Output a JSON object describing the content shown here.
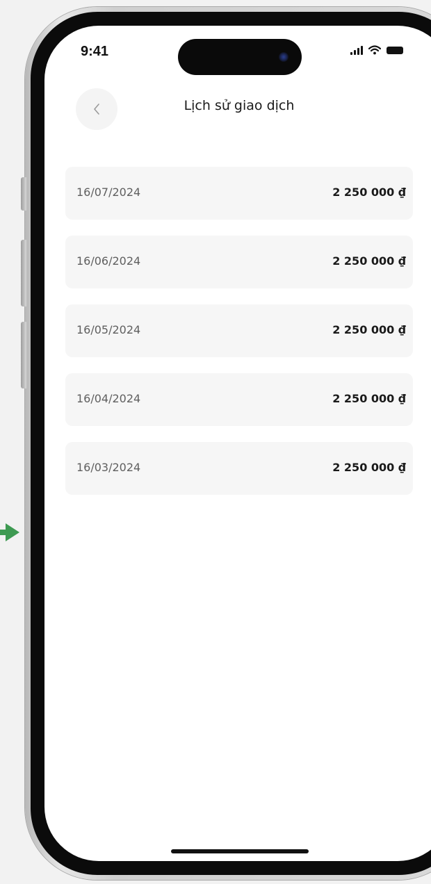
{
  "status_bar": {
    "time": "9:41",
    "icons": [
      "signal-icon",
      "wifi-icon",
      "battery-icon"
    ]
  },
  "header": {
    "back_icon": "chevron-left-icon",
    "title": "Lịch sử giao dịch"
  },
  "transactions": [
    {
      "date": "16/07/2024",
      "amount": "2 250 000 ₫"
    },
    {
      "date": "16/06/2024",
      "amount": "2 250 000 ₫"
    },
    {
      "date": "16/05/2024",
      "amount": "2 250 000 ₫"
    },
    {
      "date": "16/04/2024",
      "amount": "2 250 000 ₫"
    },
    {
      "date": "16/03/2024",
      "amount": "2 250 000 ₫"
    }
  ],
  "colors": {
    "row_background": "#f6f6f6",
    "connector_arrow": "#3e9a52",
    "screen_background": "#ffffff"
  }
}
